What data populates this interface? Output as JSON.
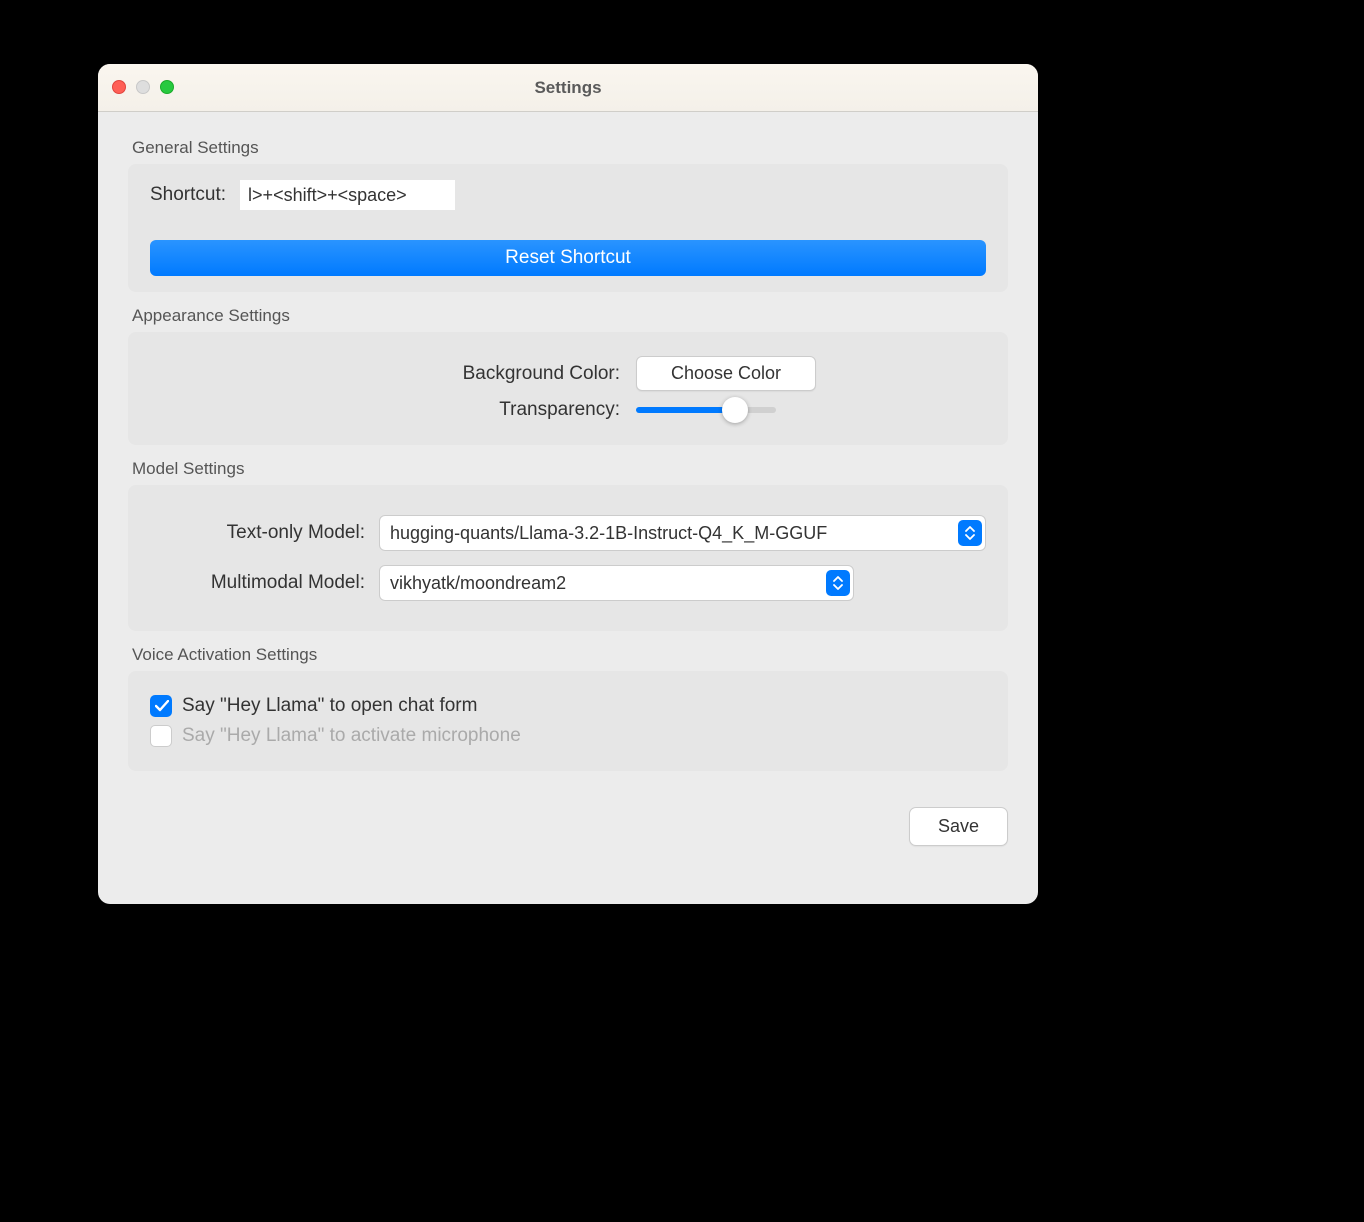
{
  "window": {
    "title": "Settings"
  },
  "general": {
    "section_label": "General Settings",
    "shortcut_label": "Shortcut:",
    "shortcut_value": "l>+<shift>+<space>",
    "reset_button": "Reset Shortcut"
  },
  "appearance": {
    "section_label": "Appearance Settings",
    "bg_color_label": "Background Color:",
    "choose_color_button": "Choose Color",
    "transparency_label": "Transparency:",
    "transparency_value": 75
  },
  "model": {
    "section_label": "Model Settings",
    "text_only_label": "Text-only Model:",
    "text_only_value": "hugging-quants/Llama-3.2-1B-Instruct-Q4_K_M-GGUF",
    "multimodal_label": "Multimodal Model:",
    "multimodal_value": "vikhyatk/moondream2"
  },
  "voice": {
    "section_label": "Voice Activation Settings",
    "open_chat_label": "Say \"Hey Llama\" to open chat form",
    "open_chat_checked": true,
    "activate_mic_label": "Say \"Hey Llama\" to activate microphone",
    "activate_mic_checked": false
  },
  "footer": {
    "save_button": "Save"
  }
}
